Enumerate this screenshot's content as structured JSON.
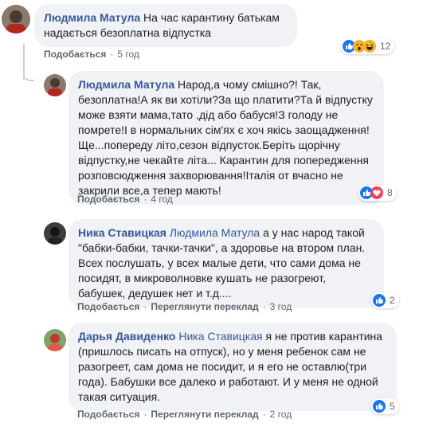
{
  "comments": [
    {
      "author": "Людмила Матула",
      "mention": "",
      "text": "На час карантину батькам надається безоплатна відпустка",
      "like_label": "Подобається",
      "reply_label": "",
      "time": "5 год",
      "reactions": [
        "like-icon",
        "wow-icon",
        "haha-icon"
      ],
      "reaction_count": "12"
    },
    {
      "author": "Людмила Матула",
      "mention": "",
      "text": "Народ,а чому смішно?! Так, безоплатна!А як ви хотіли?За що платити?Та й відпустку може взяти мама,тато ,дід або бабуся!З голоду не помрете!І в нормальних сім'ях є хоч якісь заощадження! Ще...попереду літо,сезон відпусток.Беріть щорічну відпустку,не чекайте літа... Карантин для попередження розповсюдження захворювання!Італія от вчасно не закрили все,а тепер мають!",
      "like_label": "Подобається",
      "reply_label": "",
      "time": "4 год",
      "reactions": [
        "like-icon",
        "love-icon"
      ],
      "reaction_count": "8"
    },
    {
      "author": "Ника Ставицкая",
      "mention": "Людмила Матула",
      "text": "а у нас народ такой \"бабки-бабки, тачки-тачки\", а здоровье на втором план. Всех послушать, у всех малые дети, что сами дома не посидят, в микроволновке кушать не разогреют, бабушек, дедушек нет и т.д....",
      "like_label": "Подобається",
      "reply_label": "Переглянути переклад",
      "time": "3 год",
      "reactions": [
        "like-icon"
      ],
      "reaction_count": "2"
    },
    {
      "author": "Дарья Давиденко",
      "mention": "Ника Ставицкая",
      "text": "я не против карантина (пришлось писать на отпуск), но у меня ребенок сам не разогреет, сам дома не посидит, и я его не оставлю(три года). Бабушки все далеко и работают. И у меня не одной такая ситуация.",
      "like_label": "Подобається",
      "reply_label": "Переглянути переклад",
      "time": "2 год",
      "reactions": [
        "like-icon"
      ],
      "reaction_count": "5"
    }
  ]
}
